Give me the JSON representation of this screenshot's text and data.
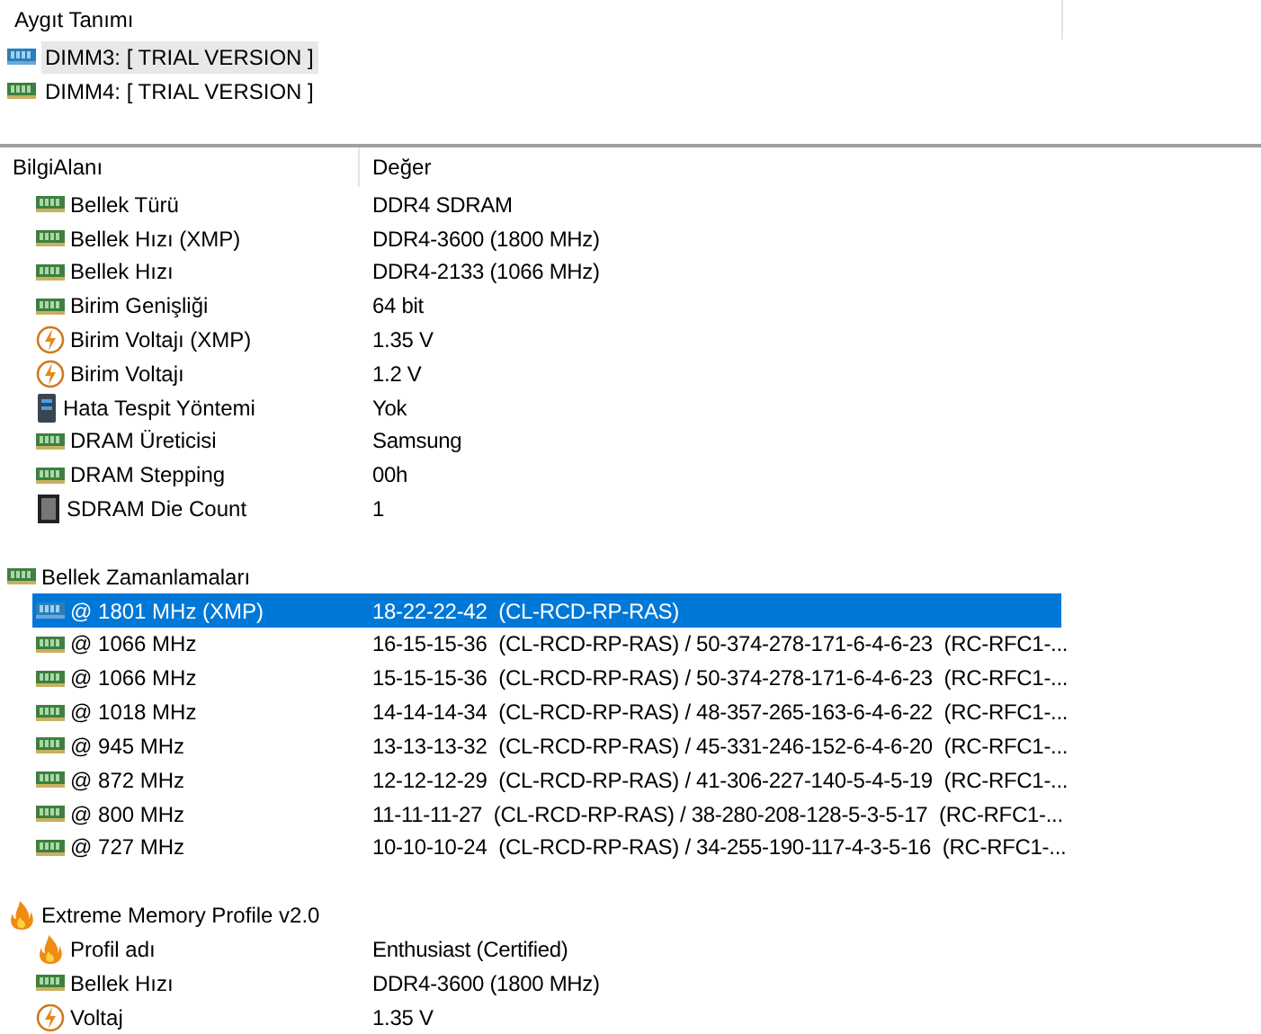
{
  "device_panel": {
    "title": "Aygıt Tanımı",
    "devices": [
      {
        "label": "DIMM3: [ TRIAL VERSION ]",
        "selected": true
      },
      {
        "label": "DIMM4: [ TRIAL VERSION ]",
        "selected": false
      }
    ]
  },
  "columns": [
    "BilgiAlanı",
    "Değer"
  ],
  "sections": [
    {
      "rows": [
        {
          "kind": "ram",
          "field": "Bellek Türü",
          "value": "DDR4 SDRAM",
          "selected": false
        },
        {
          "kind": "ram",
          "field": "Bellek Hızı (XMP)",
          "value": "DDR4-3600 (1800 MHz)",
          "selected": false
        },
        {
          "kind": "ram",
          "field": "Bellek Hızı",
          "value": "DDR4-2133 (1066 MHz)",
          "selected": false
        },
        {
          "kind": "ram",
          "field": "Birim Genişliği",
          "value": "64 bit",
          "selected": false
        },
        {
          "kind": "voltage",
          "field": "Birim Voltajı (XMP)",
          "value": "1.35 V",
          "selected": false
        },
        {
          "kind": "voltage",
          "field": "Birim Voltajı",
          "value": "1.2 V",
          "selected": false
        },
        {
          "kind": "server",
          "field": "Hata Tespit Yöntemi",
          "value": "Yok",
          "selected": false
        },
        {
          "kind": "ram",
          "field": "DRAM Üreticisi",
          "value": "Samsung",
          "selected": false
        },
        {
          "kind": "ram",
          "field": "DRAM Stepping",
          "value": "00h",
          "selected": false
        },
        {
          "kind": "chip",
          "field": "SDRAM Die Count",
          "value": "1",
          "selected": false
        }
      ]
    },
    {
      "title": "Bellek Zamanlamaları",
      "kind": "ram",
      "rows": [
        {
          "kind": "ram",
          "field": "@ 1801 MHz (XMP)",
          "value": "18-22-22-42  (CL-RCD-RP-RAS)",
          "selected": true
        },
        {
          "kind": "ram",
          "field": "@ 1066 MHz",
          "value": "16-15-15-36  (CL-RCD-RP-RAS) / 50-374-278-171-6-4-6-23  (RC-RFC1-...",
          "selected": false
        },
        {
          "kind": "ram",
          "field": "@ 1066 MHz",
          "value": "15-15-15-36  (CL-RCD-RP-RAS) / 50-374-278-171-6-4-6-23  (RC-RFC1-...",
          "selected": false
        },
        {
          "kind": "ram",
          "field": "@ 1018 MHz",
          "value": "14-14-14-34  (CL-RCD-RP-RAS) / 48-357-265-163-6-4-6-22  (RC-RFC1-...",
          "selected": false
        },
        {
          "kind": "ram",
          "field": "@ 945 MHz",
          "value": "13-13-13-32  (CL-RCD-RP-RAS) / 45-331-246-152-6-4-6-20  (RC-RFC1-...",
          "selected": false
        },
        {
          "kind": "ram",
          "field": "@ 872 MHz",
          "value": "12-12-12-29  (CL-RCD-RP-RAS) / 41-306-227-140-5-4-5-19  (RC-RFC1-...",
          "selected": false
        },
        {
          "kind": "ram",
          "field": "@ 800 MHz",
          "value": "11-11-11-27  (CL-RCD-RP-RAS) / 38-280-208-128-5-3-5-17  (RC-RFC1-...",
          "selected": false
        },
        {
          "kind": "ram",
          "field": "@ 727 MHz",
          "value": "10-10-10-24  (CL-RCD-RP-RAS) / 34-255-190-117-4-3-5-16  (RC-RFC1-...",
          "selected": false
        }
      ]
    },
    {
      "title": "Extreme Memory Profile v2.0",
      "kind": "flame",
      "rows": [
        {
          "kind": "flame",
          "field": "Profil adı",
          "value": "Enthusiast (Certified)",
          "selected": false
        },
        {
          "kind": "ram",
          "field": "Bellek Hızı",
          "value": "DDR4-3600 (1800 MHz)",
          "selected": false
        },
        {
          "kind": "voltage",
          "field": "Voltaj",
          "value": "1.35 V",
          "selected": false
        }
      ]
    }
  ]
}
